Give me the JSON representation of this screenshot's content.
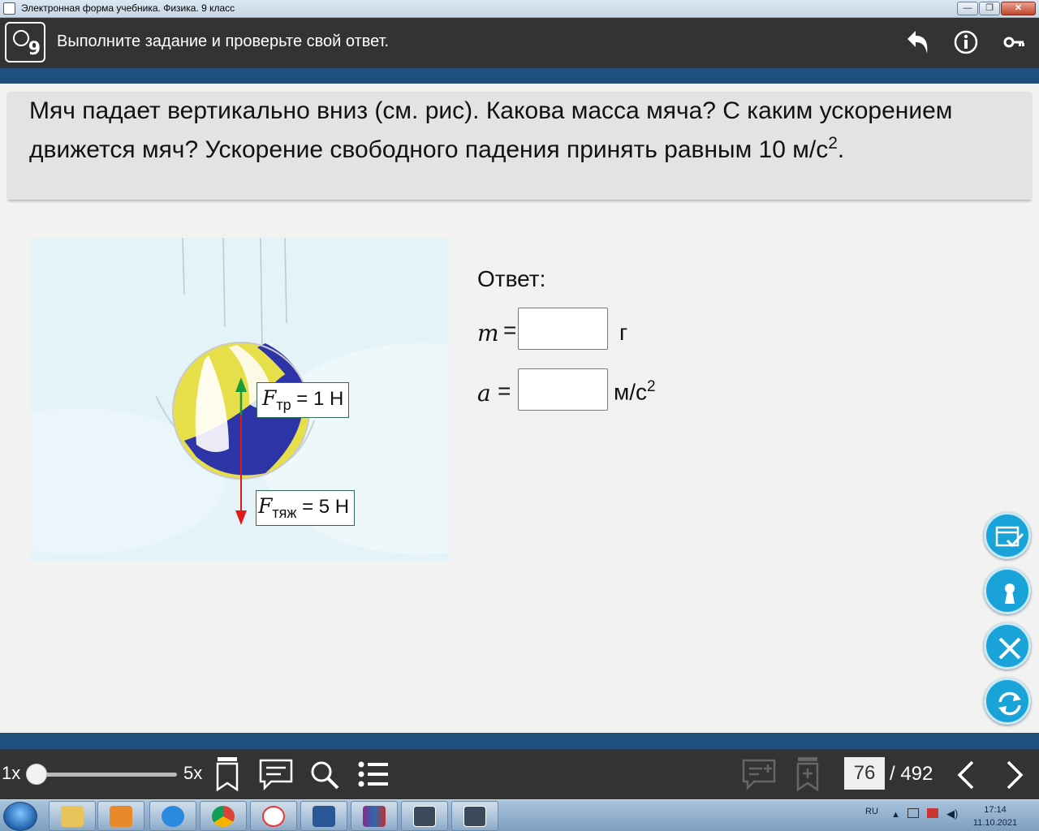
{
  "window": {
    "title": "Электронная форма учебника. Физика. 9 класс",
    "buttons": {
      "minimize": "—",
      "maximize": "❐",
      "close": "✕"
    }
  },
  "header": {
    "logo_number": "9",
    "title": "Выполните задание и проверьте свой ответ.",
    "icons": [
      "back-icon",
      "info-icon",
      "key-icon"
    ]
  },
  "question": {
    "text": "Мяч падает вертикально вниз (см. рис). Какова масса мяча? С каким ускорением движется мяч? Ускорение свободного падения принять равным 10 м/с",
    "exponent": "2",
    "end": "."
  },
  "figure": {
    "friction_force": {
      "symbol": "F",
      "subscript": "тр",
      "value": " = 1 Н"
    },
    "gravity_force": {
      "symbol": "F",
      "subscript": "тяж",
      "value": " = 5 Н"
    }
  },
  "answer": {
    "heading": "Ответ:",
    "mass": {
      "var": "m",
      "eq": "=",
      "value": "",
      "unit": "г"
    },
    "acceleration": {
      "var": "a",
      "eq": "=",
      "value": "",
      "unit": "м/с",
      "unit_exp": "2"
    }
  },
  "side_buttons": [
    "check-icon",
    "keyhole-icon",
    "close-icon",
    "refresh-icon"
  ],
  "bottom": {
    "zoom_min": "1x",
    "zoom_max": "5x",
    "zoom_level": 0,
    "page_current": "76",
    "page_total": "/ 492"
  },
  "taskbar": {
    "apps": [
      "explorer",
      "media-player",
      "internet-explorer",
      "chrome",
      "yandex",
      "word",
      "winrar",
      "physics-9",
      "chemistry-7"
    ],
    "language": "RU",
    "time": "17:14",
    "date": "11.10.2021"
  },
  "colors": {
    "header": "#333333",
    "accent_stripe": "#1f4f7d",
    "fab": "#1aa3d9",
    "friction_arrow": "#1a9a3a",
    "gravity_arrow": "#e01818"
  }
}
